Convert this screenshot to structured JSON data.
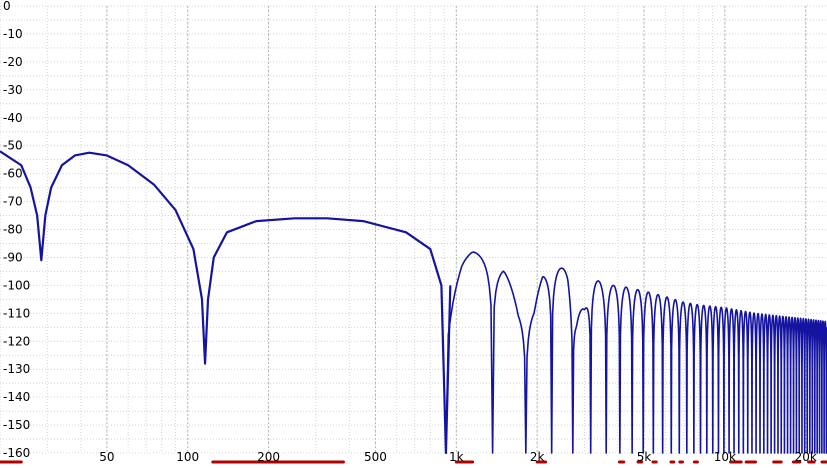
{
  "chart_data": {
    "type": "line",
    "title": "",
    "xlabel": "",
    "ylabel": "",
    "x_scale": "log",
    "xlim": [
      20,
      24000
    ],
    "ylim": [
      -160,
      0
    ],
    "grid": true,
    "y_ticks": [
      {
        "value": 0,
        "label": "0"
      },
      {
        "value": -10,
        "label": "-10"
      },
      {
        "value": -20,
        "label": "-20"
      },
      {
        "value": -30,
        "label": "-30"
      },
      {
        "value": -40,
        "label": "-40"
      },
      {
        "value": -50,
        "label": "-50"
      },
      {
        "value": -60,
        "label": "-60"
      },
      {
        "value": -70,
        "label": "-70"
      },
      {
        "value": -80,
        "label": "-80"
      },
      {
        "value": -90,
        "label": "-90"
      },
      {
        "value": -100,
        "label": "-100"
      },
      {
        "value": -110,
        "label": "-110"
      },
      {
        "value": -120,
        "label": "-120"
      },
      {
        "value": -130,
        "label": "-130"
      },
      {
        "value": -140,
        "label": "-140"
      },
      {
        "value": -150,
        "label": "-150"
      },
      {
        "value": -160,
        "label": "-160"
      }
    ],
    "x_ticks": [
      {
        "value": 50,
        "label": "50"
      },
      {
        "value": 100,
        "label": "100"
      },
      {
        "value": 200,
        "label": "200"
      },
      {
        "value": 500,
        "label": "500"
      },
      {
        "value": 1000,
        "label": "1k"
      },
      {
        "value": 2000,
        "label": "2k"
      },
      {
        "value": 5000,
        "label": "5k"
      },
      {
        "value": 10000,
        "label": "10k"
      },
      {
        "value": 20000,
        "label": "20k"
      }
    ],
    "series": [
      {
        "color": "#1414a0",
        "first_null_hz": 28.5,
        "lobe_spacing_hz": 450,
        "points": [
          [
            20,
            -52
          ],
          [
            24,
            -57
          ],
          [
            26,
            -65
          ],
          [
            27.5,
            -75
          ],
          [
            28.5,
            -91
          ],
          [
            29.5,
            -75
          ],
          [
            31,
            -65
          ],
          [
            34,
            -57
          ],
          [
            38,
            -53.5
          ],
          [
            43,
            -52.5
          ],
          [
            50,
            -53.5
          ],
          [
            60,
            -57
          ],
          [
            75,
            -64
          ],
          [
            90,
            -73
          ],
          [
            105,
            -87
          ],
          [
            113,
            -105
          ],
          [
            116,
            -128
          ],
          [
            119,
            -105
          ],
          [
            125,
            -90
          ],
          [
            140,
            -81
          ],
          [
            180,
            -77
          ],
          [
            250,
            -76
          ],
          [
            330,
            -76
          ],
          [
            450,
            -77
          ],
          [
            650,
            -81
          ],
          [
            800,
            -87
          ],
          [
            880,
            -100
          ],
          [
            915,
            -160
          ],
          [
            950,
            -100
          ],
          [
            1050,
            -91
          ],
          [
            1150,
            -88
          ],
          [
            1300,
            -88
          ],
          [
            1500,
            -93
          ],
          [
            1700,
            -108
          ],
          [
            1830,
            -160
          ],
          [
            1950,
            -108
          ],
          [
            2100,
            -96
          ],
          [
            2300,
            -92
          ],
          [
            2600,
            -95
          ],
          [
            2800,
            -110
          ],
          [
            2740,
            -160
          ],
          [
            3000,
            -108
          ],
          [
            3200,
            -97
          ],
          [
            3600,
            -100
          ],
          [
            3650,
            -160
          ],
          [
            4000,
            -100
          ],
          [
            4570,
            -160
          ],
          [
            5000,
            -102
          ],
          [
            5480,
            -160
          ],
          [
            6000,
            -104
          ],
          [
            6400,
            -160
          ],
          [
            7000,
            -106
          ],
          [
            7300,
            -160
          ],
          [
            8000,
            -107
          ],
          [
            9140,
            -160
          ],
          [
            10000,
            -108
          ],
          [
            11900,
            -160
          ],
          [
            13000,
            -110
          ],
          [
            16000,
            -111
          ],
          [
            20000,
            -112
          ],
          [
            24000,
            -113
          ]
        ]
      }
    ],
    "frequency_marker_bands": [
      [
        20,
        24
      ],
      [
        124,
        148
      ],
      [
        148,
        185
      ],
      [
        185,
        240
      ],
      [
        240,
        330
      ],
      [
        330,
        380
      ],
      [
        1000,
        1150
      ],
      [
        2000,
        2150
      ],
      [
        4050,
        4200
      ],
      [
        4750,
        4900
      ],
      [
        5400,
        5550
      ],
      [
        6300,
        6450
      ],
      [
        6800,
        6950
      ],
      [
        7700,
        7900
      ],
      [
        10500,
        11500
      ],
      [
        12000,
        13000
      ],
      [
        15200,
        16200
      ],
      [
        18000,
        19000
      ],
      [
        20500,
        21500
      ],
      [
        23000,
        24000
      ]
    ]
  }
}
